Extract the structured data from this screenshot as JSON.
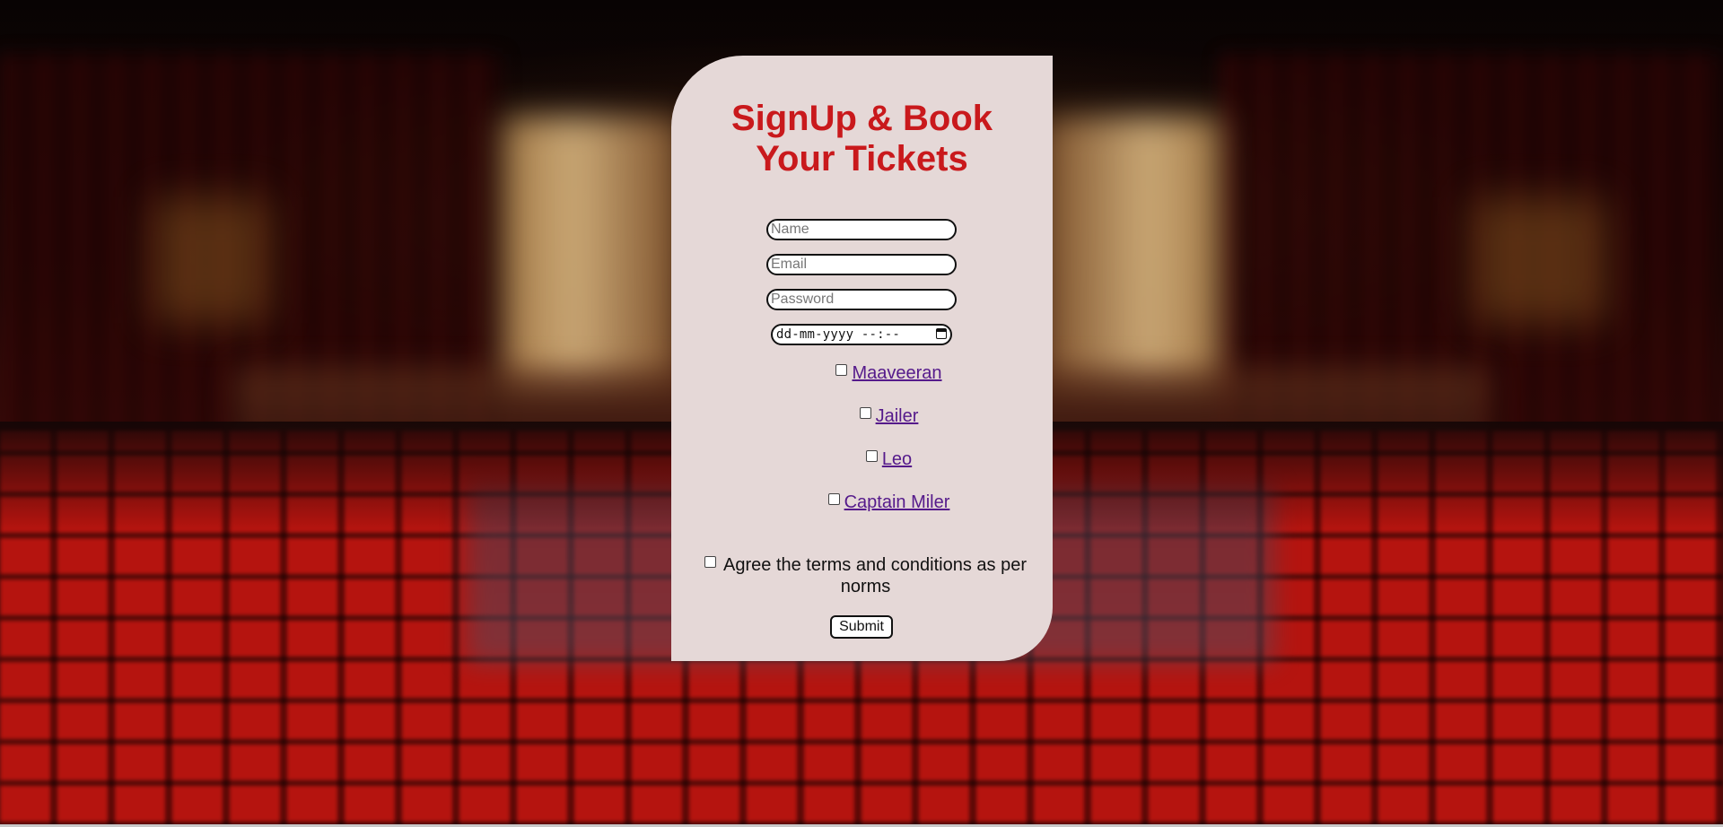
{
  "form": {
    "title": "SignUp & Book Your Tickets",
    "name_placeholder": "Name",
    "email_placeholder": "Email",
    "password_placeholder": "Password",
    "date_placeholder": "dd-mm-yyyy --:--",
    "movies": [
      {
        "label": "Maaveeran",
        "checked": false
      },
      {
        "label": "Jailer",
        "checked": false
      },
      {
        "label": "Leo",
        "checked": false
      },
      {
        "label": "Captain Miler",
        "checked": false
      }
    ],
    "terms_label": "Agree the terms and conditions as per norms",
    "submit_label": "Submit"
  },
  "colors": {
    "title": "#c9191c",
    "card_background": "#e5d8d7",
    "link": "#551a8b"
  },
  "icons": {
    "date_picker": "calendar-icon"
  }
}
